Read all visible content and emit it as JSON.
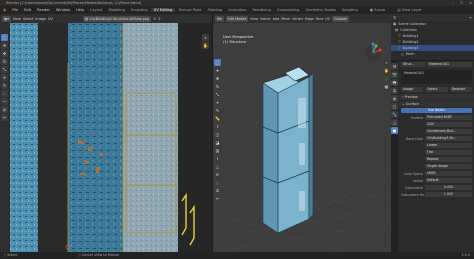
{
  "window": {
    "title": "Blender [C:\\Users\\dusty\\Documents\\MyPlaces\\Models\\Building\\..\\CyPlace.blend]",
    "controls": [
      "–",
      "☐",
      "✕"
    ]
  },
  "menu": {
    "items": [
      "File",
      "Edit",
      "Render",
      "Window",
      "Help"
    ],
    "workspaces": [
      "Layout",
      "Modeling",
      "Sculpting",
      "UV Editing",
      "Texture Paint",
      "Shading",
      "Animation",
      "Rendering",
      "Compositing",
      "Geometry Nodes",
      "Scripting"
    ],
    "active_workspace": "UV Editing",
    "scene_label": "Scene",
    "view_layer": "View Layer"
  },
  "uv_editor": {
    "header": [
      "View",
      "Select",
      "Image",
      "UV"
    ],
    "image_name": "CityBuilding3.Structure-Diffuse.png"
  },
  "viewport": {
    "mode": "Edit Mode",
    "header": [
      "View",
      "Select",
      "Add",
      "Mesh",
      "Vertex",
      "Edge",
      "Face",
      "UV"
    ],
    "transform": "Global",
    "perspective_label": "User Perspective",
    "object_label": "(1) Structure"
  },
  "outliner": {
    "rows": [
      {
        "name": "Scene Collection",
        "selected": false
      },
      {
        "name": "Collection",
        "selected": false
      },
      {
        "name": "Building1",
        "selected": false
      },
      {
        "name": "Building2",
        "selected": false
      },
      {
        "name": "Building3",
        "selected": true
      },
      {
        "name": "Mesh",
        "selected": false
      }
    ]
  },
  "properties": {
    "object_name": "Struc...",
    "material_name": "Material.001",
    "slot_name": "Material.001",
    "tabs": [
      "Assign",
      "Select",
      "Deselect"
    ],
    "sections": [
      "Preview",
      "Surface"
    ],
    "use_nodes": "Use Nodes",
    "surface_label": "Surface",
    "surface_value": "Principled BSDF",
    "ggx": "GGX",
    "christensen": "Christensen-Burl...",
    "base_color_label": "Base Color",
    "base_color_value": "CityBuilding3.Str...",
    "linear": "Linear",
    "flat": "Flat",
    "repeat": "Repeat",
    "single_image": "Single Image",
    "color_space_label": "Color Space",
    "color_space_value": "sRGB",
    "vector_label": "Vector",
    "vector_value": "Default",
    "subsurface_label": "Subsurface",
    "subsurface_value": "0.000",
    "subsurface_radius_label": "Subsurface Ra...",
    "subsurface_radius_value": "1.000"
  },
  "status": {
    "left": "Select",
    "middle": "Center View to Mouse",
    "right": "3.0.0"
  },
  "colors": {
    "accent": "#4772b3",
    "viewport_bg": "#3d3d3d",
    "uv_bg": "#2a2a2a",
    "model_blue": "#6fa9c8",
    "gold": "#c9a43a"
  }
}
